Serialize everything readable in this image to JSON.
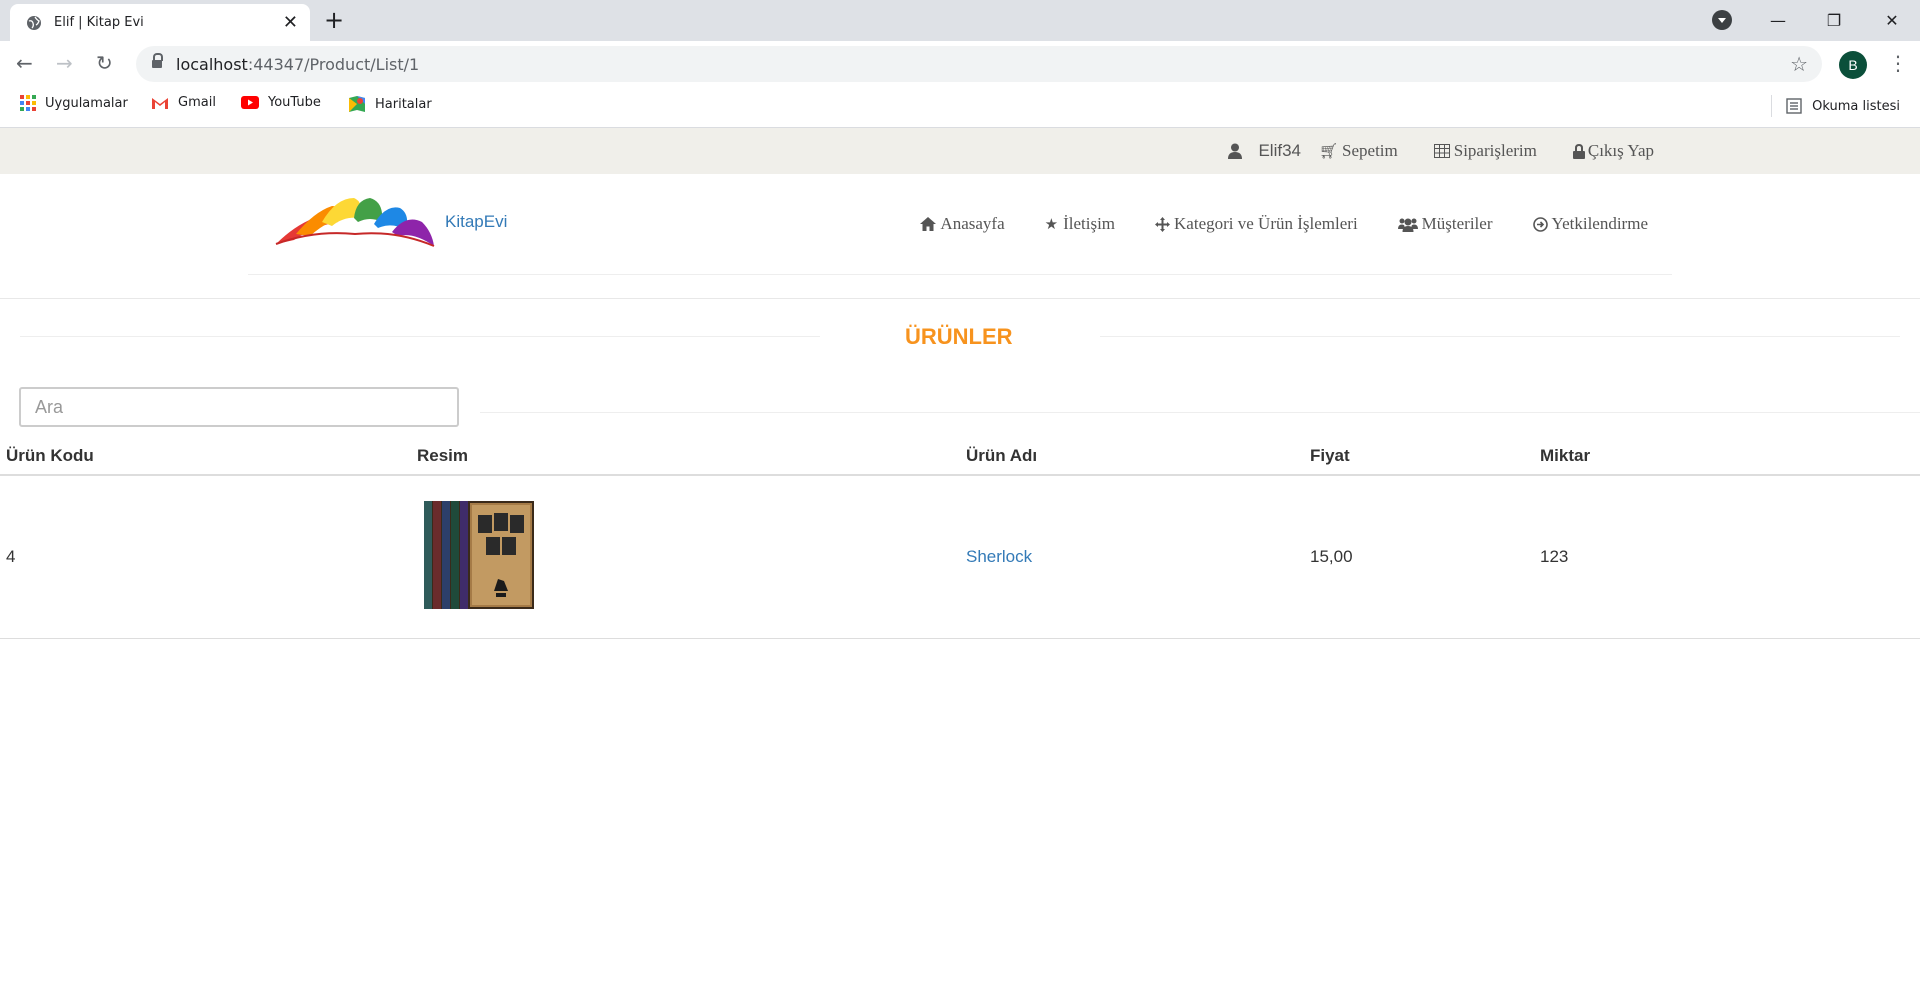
{
  "browser": {
    "tab_title": "Elif | Kitap Evi",
    "url_host": "localhost",
    "url_path": ":44347/Product/List/1",
    "profile_initial": "B",
    "bookmarks": [
      {
        "label": "Uygulamalar",
        "icon": "apps-grid-icon"
      },
      {
        "label": "Gmail",
        "icon": "gmail-icon"
      },
      {
        "label": "YouTube",
        "icon": "youtube-icon"
      },
      {
        "label": "Haritalar",
        "icon": "maps-icon"
      }
    ],
    "reading_list": "Okuma listesi"
  },
  "topbar": {
    "username": "Elif34",
    "cart": "Sepetim",
    "orders": "Siparişlerim",
    "logout": "Çıkış Yap"
  },
  "header": {
    "brand": "KitapEvi",
    "nav": [
      {
        "label": "Anasayfa",
        "icon": "home-icon"
      },
      {
        "label": "İletişim",
        "icon": "star-icon"
      },
      {
        "label": "Kategori ve Ürün İşlemleri",
        "icon": "move-icon"
      },
      {
        "label": "Müşteriler",
        "icon": "users-icon"
      },
      {
        "label": "Yetkilendirme",
        "icon": "circle-arrow-icon"
      }
    ]
  },
  "main": {
    "section_title": "ÜRÜNLER",
    "search_placeholder": "Ara",
    "columns": [
      "Ürün Kodu",
      "Resim",
      "Ürün Adı",
      "Fiyat",
      "Miktar"
    ],
    "rows": [
      {
        "code": "4",
        "name": "Sherlock",
        "price": "15,00",
        "quantity": "123"
      }
    ]
  },
  "colors": {
    "accent_orange": "#f7931e",
    "link_blue": "#337ab7",
    "topbar_bg": "#f0efea"
  }
}
